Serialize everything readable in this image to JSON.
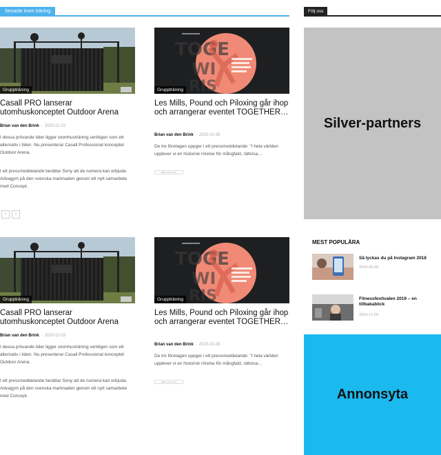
{
  "main": {
    "section_label": "Senaste inom träning",
    "rows": [
      [
        {
          "category": "Gruppträning",
          "title": "Casall PRO lanserar utomhuskonceptet Outdoor Arena",
          "author": "Brian van den Brink",
          "date": "2020-11-03",
          "excerpt_1": "I dessa prövande tider ligger utomhusträning verkligen som ett alternativ i tiden. Nu presenterar Casall Professional konceptet Outdoor Arena.",
          "excerpt_2": "I ett pressmeddelande berättar Sony att de numera kan erbjuda Advagym på den svenska marknaden genom ett nytt samarbete med Concept."
        },
        {
          "category": "Gruppträning",
          "title": "Les Mills, Pound och Piloxing går ihop och arrangerar eventet TOGETHER…",
          "author": "Brian van den Brink",
          "date": "2020-10-28",
          "excerpt_1": "De tre företagen uppger i ett pressmeddelande: \"I hela världen upplever vi en historisk rörelse för mångfald, rättvisa…",
          "readmore": "Make your move"
        }
      ],
      [
        {
          "category": "Gruppträning",
          "title": "Casall PRO lanserar utomhuskonceptet Outdoor Arena",
          "author": "Brian van den Brink",
          "date": "2020-11-03",
          "excerpt_1": "I dessa prövande tider ligger utomhusträning verkligen som ett alternativ i tiden. Nu presenterar Casall Professional konceptet Outdoor Arena.",
          "excerpt_2": "I ett pressmeddelande berättar Sony att de numera kan erbjuda Advagym på den svenska marknaden genom ett nytt samarbete med Concept."
        },
        {
          "category": "Gruppträning",
          "title": "Les Mills, Pound och Piloxing går ihop och arrangerar eventet TOGETHER…",
          "author": "Brian van den Brink",
          "date": "2020-10-28",
          "excerpt_1": "De tre företagen uppger i ett pressmeddelande: \"I hela världen upplever vi en historisk rörelse för mångfald, rättvisa…",
          "readmore": "Make your move"
        }
      ]
    ],
    "pager": {
      "prev": "‹",
      "next": "›"
    }
  },
  "sidebar": {
    "follow_label": "Följ oss",
    "silver_label": "Silver-partners",
    "popular_title": "MEST POPULÄRA",
    "popular": [
      {
        "title": "Så lyckas du på Instagram 2018",
        "date": "2018-09-28"
      },
      {
        "title": "Fitnessfestivalen 2019 – en tillbakablick",
        "date": "2019-12-26"
      }
    ],
    "ad_label": "Annonsyta"
  },
  "colors": {
    "accent": "#4db2ec",
    "silver": "#c3c3c3",
    "ad": "#1ab9ee",
    "dark": "#222222"
  },
  "icons": {
    "pager_prev": "chevron-left-icon",
    "pager_next": "chevron-right-icon"
  }
}
